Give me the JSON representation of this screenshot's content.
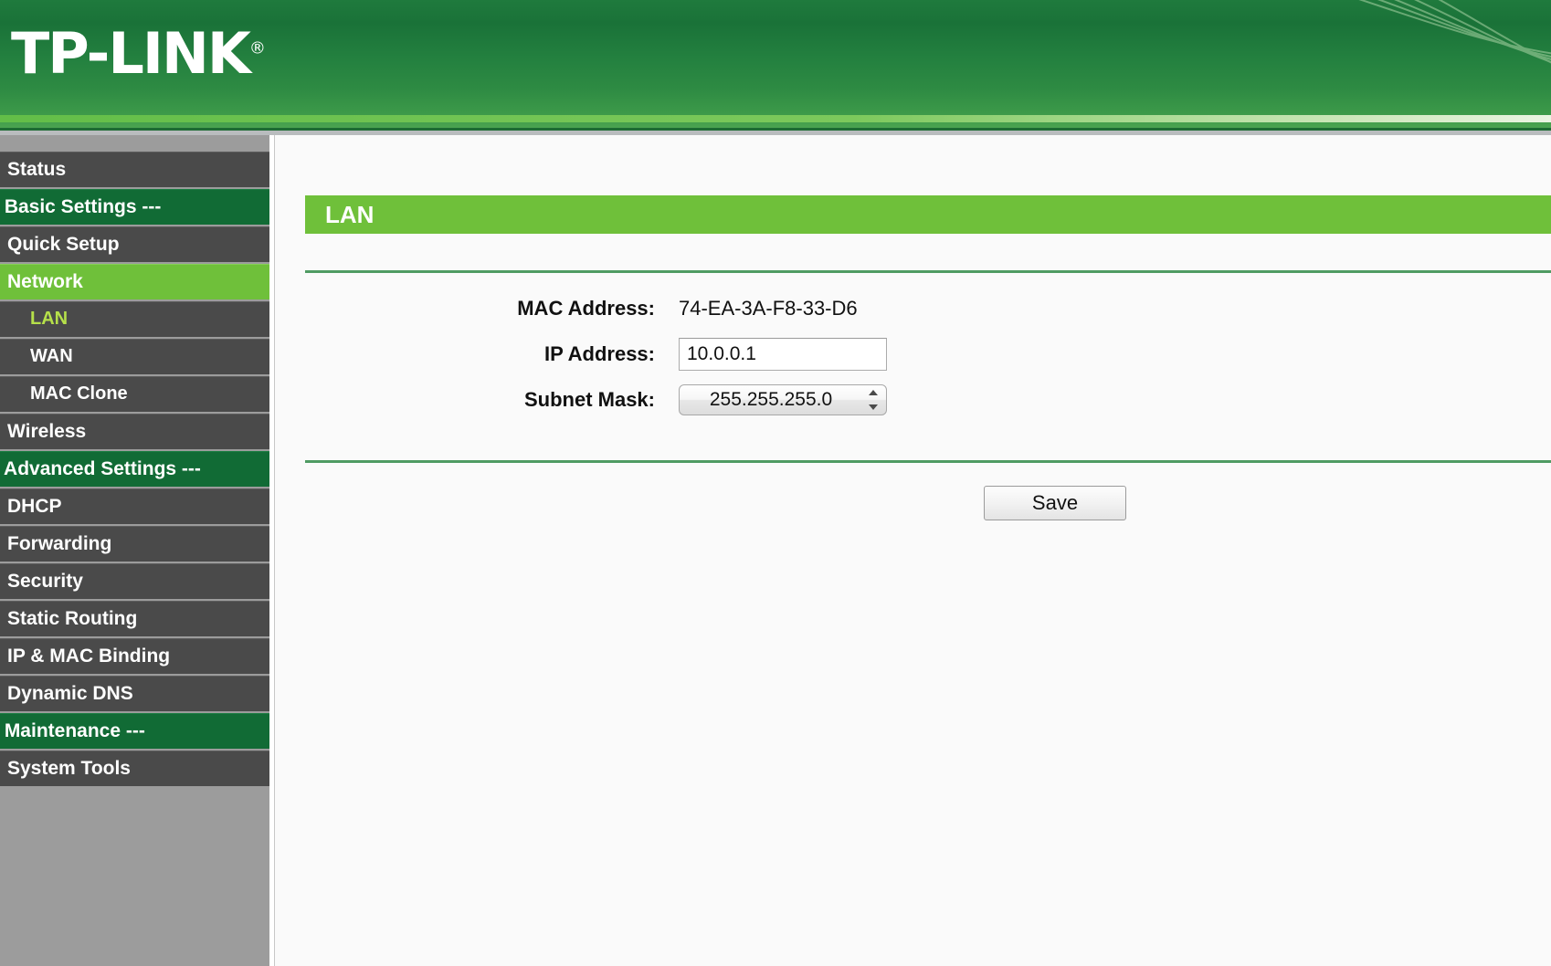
{
  "brand": {
    "name": "TP-LINK",
    "trademark": "®"
  },
  "sidebar": {
    "items": [
      {
        "label": "Status",
        "type": "item"
      },
      {
        "label": "--- Basic Settings ---",
        "type": "section"
      },
      {
        "label": "Quick Setup",
        "type": "item"
      },
      {
        "label": "Network",
        "type": "active"
      },
      {
        "label": "LAN",
        "type": "sub-current"
      },
      {
        "label": "WAN",
        "type": "sub"
      },
      {
        "label": "MAC Clone",
        "type": "sub"
      },
      {
        "label": "Wireless",
        "type": "item"
      },
      {
        "label": "--- Advanced Settings ---",
        "type": "section"
      },
      {
        "label": "DHCP",
        "type": "item"
      },
      {
        "label": "Forwarding",
        "type": "item"
      },
      {
        "label": "Security",
        "type": "item"
      },
      {
        "label": "Static Routing",
        "type": "item"
      },
      {
        "label": "IP & MAC Binding",
        "type": "item"
      },
      {
        "label": "Dynamic DNS",
        "type": "item"
      },
      {
        "label": "--- Maintenance ---",
        "type": "section"
      },
      {
        "label": "System Tools",
        "type": "item"
      }
    ]
  },
  "main": {
    "panel_title": "LAN",
    "fields": {
      "mac_label": "MAC Address:",
      "mac_value": "74-EA-3A-F8-33-D6",
      "ip_label": "IP Address:",
      "ip_value": "10.0.0.1",
      "subnet_label": "Subnet Mask:",
      "subnet_value": "255.255.255.0"
    },
    "save_label": "Save"
  },
  "colors": {
    "header_green": "#1f7a3d",
    "accent_green": "#6fc03a",
    "section_green": "#116b35",
    "sidebar_item": "#4a4a4a",
    "sidebar_bg": "#9c9c9c",
    "sub_current_text": "#b6e04a",
    "rule_green": "#4f9b63"
  }
}
